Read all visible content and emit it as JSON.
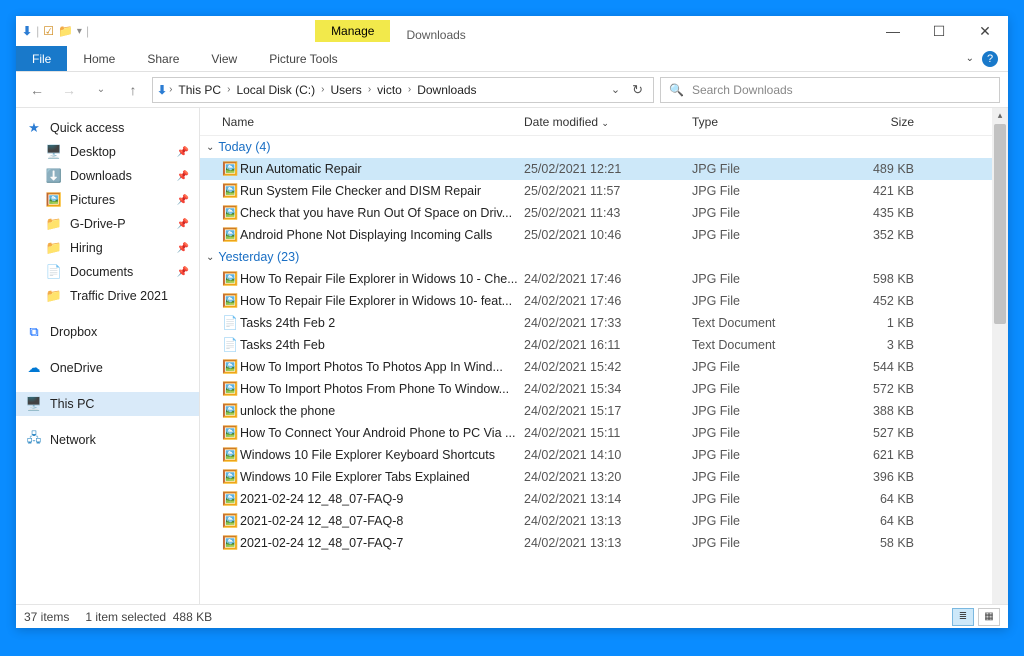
{
  "title_context": {
    "manage": "Manage",
    "folder": "Downloads"
  },
  "ribbon": {
    "file": "File",
    "tabs": [
      "Home",
      "Share",
      "View"
    ],
    "picture_tools": "Picture Tools"
  },
  "breadcrumbs": [
    "This PC",
    "Local Disk (C:)",
    "Users",
    "victo",
    "Downloads"
  ],
  "search": {
    "placeholder": "Search Downloads"
  },
  "sidebar": {
    "quick_access": "Quick access",
    "items": [
      {
        "icon": "🖥️",
        "label": "Desktop",
        "pinned": true
      },
      {
        "icon": "⬇️",
        "label": "Downloads",
        "pinned": true
      },
      {
        "icon": "🖼️",
        "label": "Pictures",
        "pinned": true
      },
      {
        "icon": "📁",
        "label": "G-Drive-P",
        "pinned": true
      },
      {
        "icon": "📁",
        "label": "Hiring",
        "pinned": true
      },
      {
        "icon": "📄",
        "label": "Documents",
        "pinned": true
      },
      {
        "icon": "📁",
        "label": "Traffic Drive 2021",
        "pinned": false
      }
    ],
    "dropbox": "Dropbox",
    "onedrive": "OneDrive",
    "thispc": "This PC",
    "network": "Network"
  },
  "columns": {
    "name": "Name",
    "date": "Date modified",
    "type": "Type",
    "size": "Size"
  },
  "groups": [
    {
      "label": "Today (4)",
      "files": [
        {
          "name": "Run Automatic Repair",
          "date": "25/02/2021 12:21",
          "type": "JPG File",
          "size": "489 KB",
          "selected": true,
          "icon": "jpg"
        },
        {
          "name": "Run System File Checker and DISM Repair",
          "date": "25/02/2021 11:57",
          "type": "JPG File",
          "size": "421 KB",
          "icon": "jpg"
        },
        {
          "name": "Check that you have Run Out Of Space on Driv...",
          "date": "25/02/2021 11:43",
          "type": "JPG File",
          "size": "435 KB",
          "icon": "jpg"
        },
        {
          "name": "Android Phone Not Displaying Incoming Calls",
          "date": "25/02/2021 10:46",
          "type": "JPG File",
          "size": "352 KB",
          "icon": "jpg"
        }
      ]
    },
    {
      "label": "Yesterday (23)",
      "files": [
        {
          "name": "How To Repair File Explorer in Widows 10 - Che...",
          "date": "24/02/2021 17:46",
          "type": "JPG File",
          "size": "598 KB",
          "icon": "jpg"
        },
        {
          "name": "How To Repair File Explorer in Widows 10- feat...",
          "date": "24/02/2021 17:46",
          "type": "JPG File",
          "size": "452 KB",
          "icon": "jpg"
        },
        {
          "name": "Tasks 24th Feb 2",
          "date": "24/02/2021 17:33",
          "type": "Text Document",
          "size": "1 KB",
          "icon": "txt"
        },
        {
          "name": "Tasks 24th Feb",
          "date": "24/02/2021 16:11",
          "type": "Text Document",
          "size": "3 KB",
          "icon": "txt"
        },
        {
          "name": "How To Import Photos To Photos App In Wind...",
          "date": "24/02/2021 15:42",
          "type": "JPG File",
          "size": "544 KB",
          "icon": "jpg"
        },
        {
          "name": "How To Import Photos From Phone To Window...",
          "date": "24/02/2021 15:34",
          "type": "JPG File",
          "size": "572 KB",
          "icon": "jpg"
        },
        {
          "name": "unlock the phone",
          "date": "24/02/2021 15:17",
          "type": "JPG File",
          "size": "388 KB",
          "icon": "jpg"
        },
        {
          "name": "How To Connect Your Android Phone to PC Via ...",
          "date": "24/02/2021 15:11",
          "type": "JPG File",
          "size": "527 KB",
          "icon": "jpg"
        },
        {
          "name": "Windows 10 File Explorer Keyboard Shortcuts",
          "date": "24/02/2021 14:10",
          "type": "JPG File",
          "size": "621 KB",
          "icon": "jpg"
        },
        {
          "name": "Windows 10 File Explorer Tabs Explained",
          "date": "24/02/2021 13:20",
          "type": "JPG File",
          "size": "396 KB",
          "icon": "jpg"
        },
        {
          "name": "2021-02-24 12_48_07-FAQ-9",
          "date": "24/02/2021 13:14",
          "type": "JPG File",
          "size": "64 KB",
          "icon": "jpg"
        },
        {
          "name": "2021-02-24 12_48_07-FAQ-8",
          "date": "24/02/2021 13:13",
          "type": "JPG File",
          "size": "64 KB",
          "icon": "jpg"
        },
        {
          "name": "2021-02-24 12_48_07-FAQ-7",
          "date": "24/02/2021 13:13",
          "type": "JPG File",
          "size": "58 KB",
          "icon": "jpg"
        }
      ]
    }
  ],
  "status": {
    "count": "37 items",
    "selection": "1 item selected",
    "size": "488 KB"
  }
}
